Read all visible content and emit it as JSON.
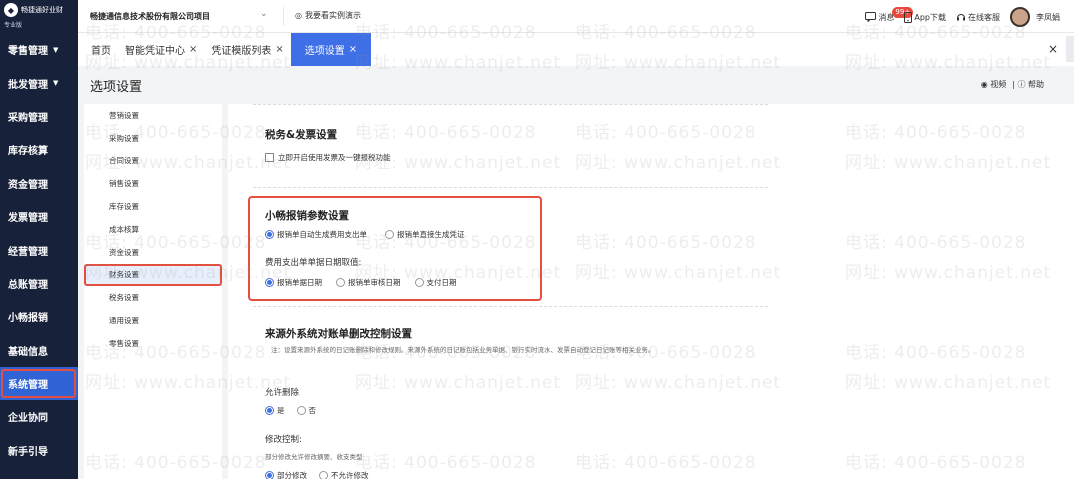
{
  "brand": {
    "logo": "◆",
    "name": "畅捷通好业财",
    "edition": "专业版"
  },
  "nav": [
    {
      "label": "零售管理",
      "caret": "▼"
    },
    {
      "label": "批发管理",
      "caret": "▼"
    },
    {
      "label": "采购管理"
    },
    {
      "label": "库存核算"
    },
    {
      "label": "资金管理"
    },
    {
      "label": "发票管理"
    },
    {
      "label": "经营管理"
    },
    {
      "label": "总账管理"
    },
    {
      "label": "小畅报销"
    },
    {
      "label": "基础信息"
    },
    {
      "label": "系统管理",
      "active": true
    },
    {
      "label": "企业协同"
    },
    {
      "label": "新手引导"
    }
  ],
  "topbar": {
    "company": "畅捷通信息技术股份有限公司项目",
    "company_caret": "⌄",
    "demo_icon": "◎",
    "demo": "我要看实例演示",
    "messages": "消息",
    "messages_badge": "99+",
    "app_download": "App下载",
    "support": "在线客服",
    "user": "李凤娟"
  },
  "tabs": [
    {
      "label": "首页",
      "closable": false
    },
    {
      "label": "智能凭证中心",
      "closable": true
    },
    {
      "label": "凭证模版列表",
      "closable": true
    },
    {
      "label": "选项设置",
      "closable": true,
      "active": true
    }
  ],
  "tabs_close": "×",
  "page": {
    "title": "选项设置",
    "video": "◉ 视频",
    "help": "| ⓘ 帮助"
  },
  "settings_nav": [
    "营销设置",
    "采购设置",
    "合同设置",
    "销售设置",
    "库存设置",
    "成本核算",
    "资金设置",
    "财务设置",
    "税务设置",
    "通用设置",
    "零售设置"
  ],
  "settings_nav_active": "财务设置",
  "sections": {
    "tax": {
      "title": "税务&发票设置",
      "checkbox": "立即开启使用发票及一键报税功能"
    },
    "expense": {
      "title": "小畅报销参数设置",
      "options": [
        "报销单自动生成费用支出单",
        "报销单直接生成凭证"
      ],
      "selected": 0,
      "date_label": "费用支出单单据日期取值:",
      "date_options": [
        "报销单据日期",
        "报销单审核日期",
        "支付日期"
      ],
      "date_selected": 0
    },
    "external": {
      "title": "来源外系统对账单删改控制设置",
      "note": "注：设置来源外系统的日记账删除和修改规则。来源外系统的日记账包括业务单据、银行实时流水、发票自动登记日记账等相关业务。",
      "allow_delete_label": "允许删除",
      "allow_delete_options": [
        "是",
        "否"
      ],
      "allow_delete_selected": 0,
      "modify_label": "修改控制:",
      "modify_note": "部分修改允许修改摘要、收支类型",
      "modify_options": [
        "部分修改",
        "不允许修改"
      ],
      "modify_selected": 0
    }
  },
  "watermark": {
    "phone": "电话: 400-665-0028",
    "site": "网址: www.chanjet.net"
  }
}
